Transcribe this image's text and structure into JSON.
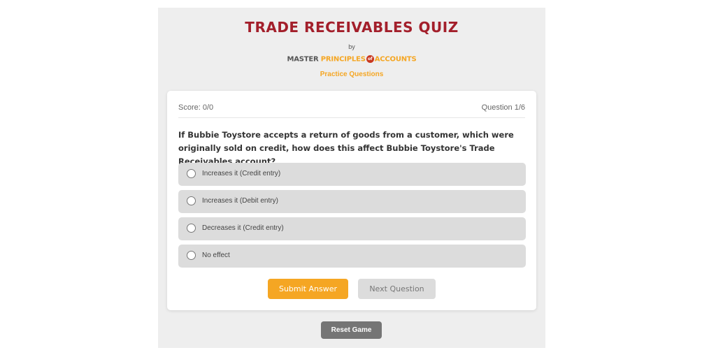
{
  "header": {
    "title": "TRADE RECEIVABLES QUIZ",
    "by": "by",
    "brand": {
      "part1": "MASTER ",
      "part2": "PRINCIPLES",
      "of": "of",
      "part3": "ACCOUNTS"
    },
    "subtitle": "Practice Questions"
  },
  "quiz": {
    "score": "Score: 0/0",
    "question_number": "Question 1/6",
    "question": "If Bubbie Toystore accepts a return of goods from a customer, which were originally sold on credit, how does this affect Bubbie Toystore's Trade Receivables account?",
    "options": [
      {
        "label": "Increases it (Credit entry)",
        "selected": false
      },
      {
        "label": "Increases it (Debit entry)",
        "selected": false
      },
      {
        "label": "Decreases it (Credit entry)",
        "selected": false
      },
      {
        "label": "No effect",
        "selected": false
      }
    ],
    "submit_label": "Submit Answer",
    "next_label": "Next Question"
  },
  "reset_label": "Reset Game",
  "colors": {
    "title": "#a31f2b",
    "accent": "#f5a623",
    "option_bg": "#dcdcdc",
    "reset_bg": "#757575"
  }
}
